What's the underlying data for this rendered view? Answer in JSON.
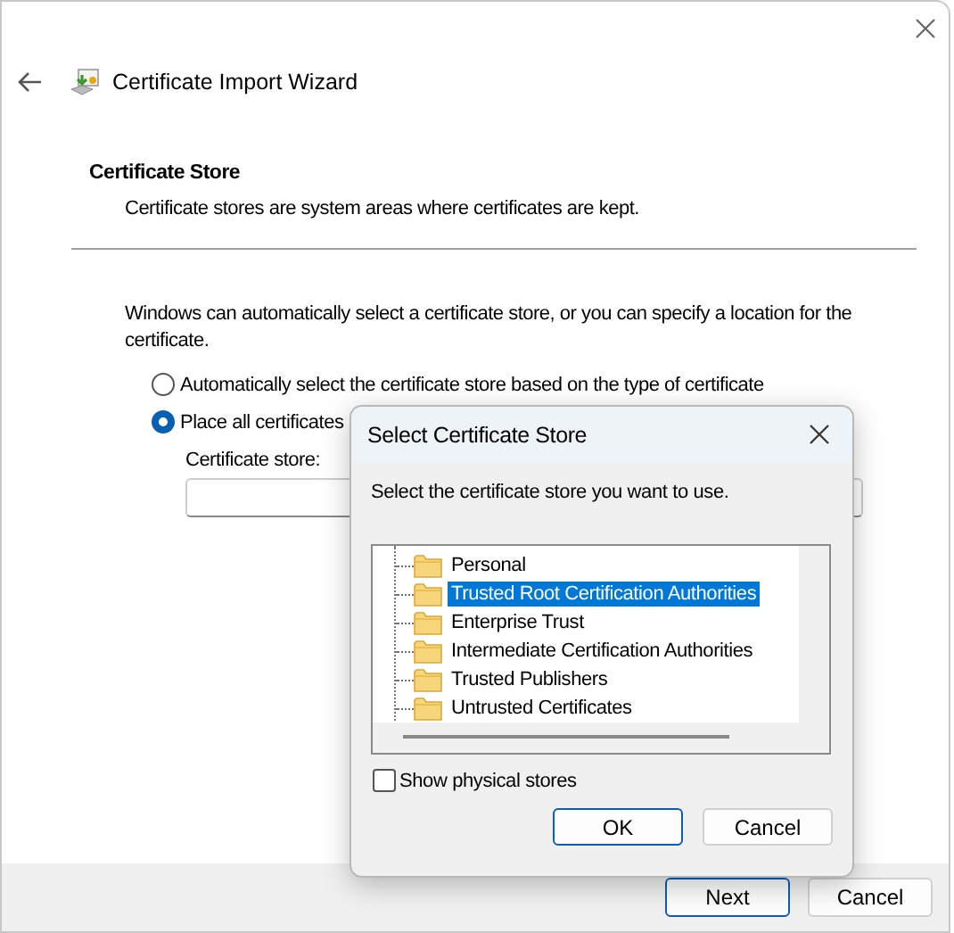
{
  "window": {
    "title": "Certificate Import Wizard"
  },
  "section": {
    "heading": "Certificate Store",
    "description": "Certificate stores are system areas where certificates are kept."
  },
  "intro": "Windows can automatically select a certificate store, or you can specify a location for the certificate.",
  "options": [
    {
      "label": "Automatically select the certificate store based on the type of certificate",
      "selected": false
    },
    {
      "label": "Place all certificates",
      "selected": true
    }
  ],
  "store_field": {
    "label": "Certificate store:"
  },
  "footer_buttons": [
    {
      "label": "Next",
      "default": true
    },
    {
      "label": "Cancel",
      "default": false
    }
  ],
  "dialog": {
    "title": "Select Certificate Store",
    "prompt": "Select the certificate store you want to use.",
    "stores": [
      {
        "label": "Personal",
        "selected": false
      },
      {
        "label": "Trusted Root Certification Authorities",
        "selected": true
      },
      {
        "label": "Enterprise Trust",
        "selected": false
      },
      {
        "label": "Intermediate Certification Authorities",
        "selected": false
      },
      {
        "label": "Trusted Publishers",
        "selected": false
      },
      {
        "label": "Untrusted Certificates",
        "selected": false
      }
    ],
    "show_physical_stores": {
      "label": "Show physical stores",
      "checked": false
    },
    "buttons": [
      {
        "label": "OK",
        "default": true
      },
      {
        "label": "Cancel",
        "default": false
      }
    ]
  }
}
